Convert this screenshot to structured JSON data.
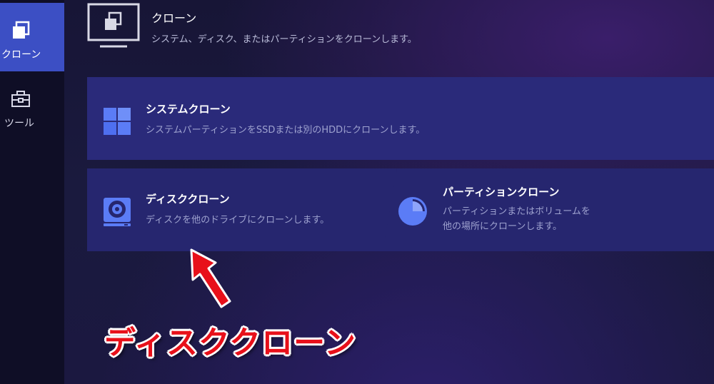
{
  "sidebar": {
    "items": [
      {
        "label": "クローン",
        "icon": "clone-icon",
        "active": true
      },
      {
        "label": "ツール",
        "icon": "toolbox-icon",
        "active": false
      }
    ]
  },
  "header": {
    "icon": "clone-monitor-icon",
    "title": "クローン",
    "description": "システム、ディスク、またはパーティションをクローンします。"
  },
  "cards": {
    "system": {
      "icon": "windows-icon",
      "title": "システムクローン",
      "description": "システムパーティションをSSDまたは別のHDDにクローンします。"
    },
    "disk": {
      "icon": "disk-icon",
      "title": "ディスククローン",
      "description": "ディスクを他のドライブにクローンします。"
    },
    "partition": {
      "icon": "pie-chart-icon",
      "title": "パーティションクローン",
      "description_line1": "パーティションまたはボリュームを",
      "description_line2": "他の場所にクローンします。"
    }
  },
  "annotation": {
    "text": "ディスククローン",
    "color": "#e8101a"
  },
  "colors": {
    "accent": "#3c4fc4",
    "card": "#2a2a7a",
    "sidebar": "#0f0e26"
  }
}
